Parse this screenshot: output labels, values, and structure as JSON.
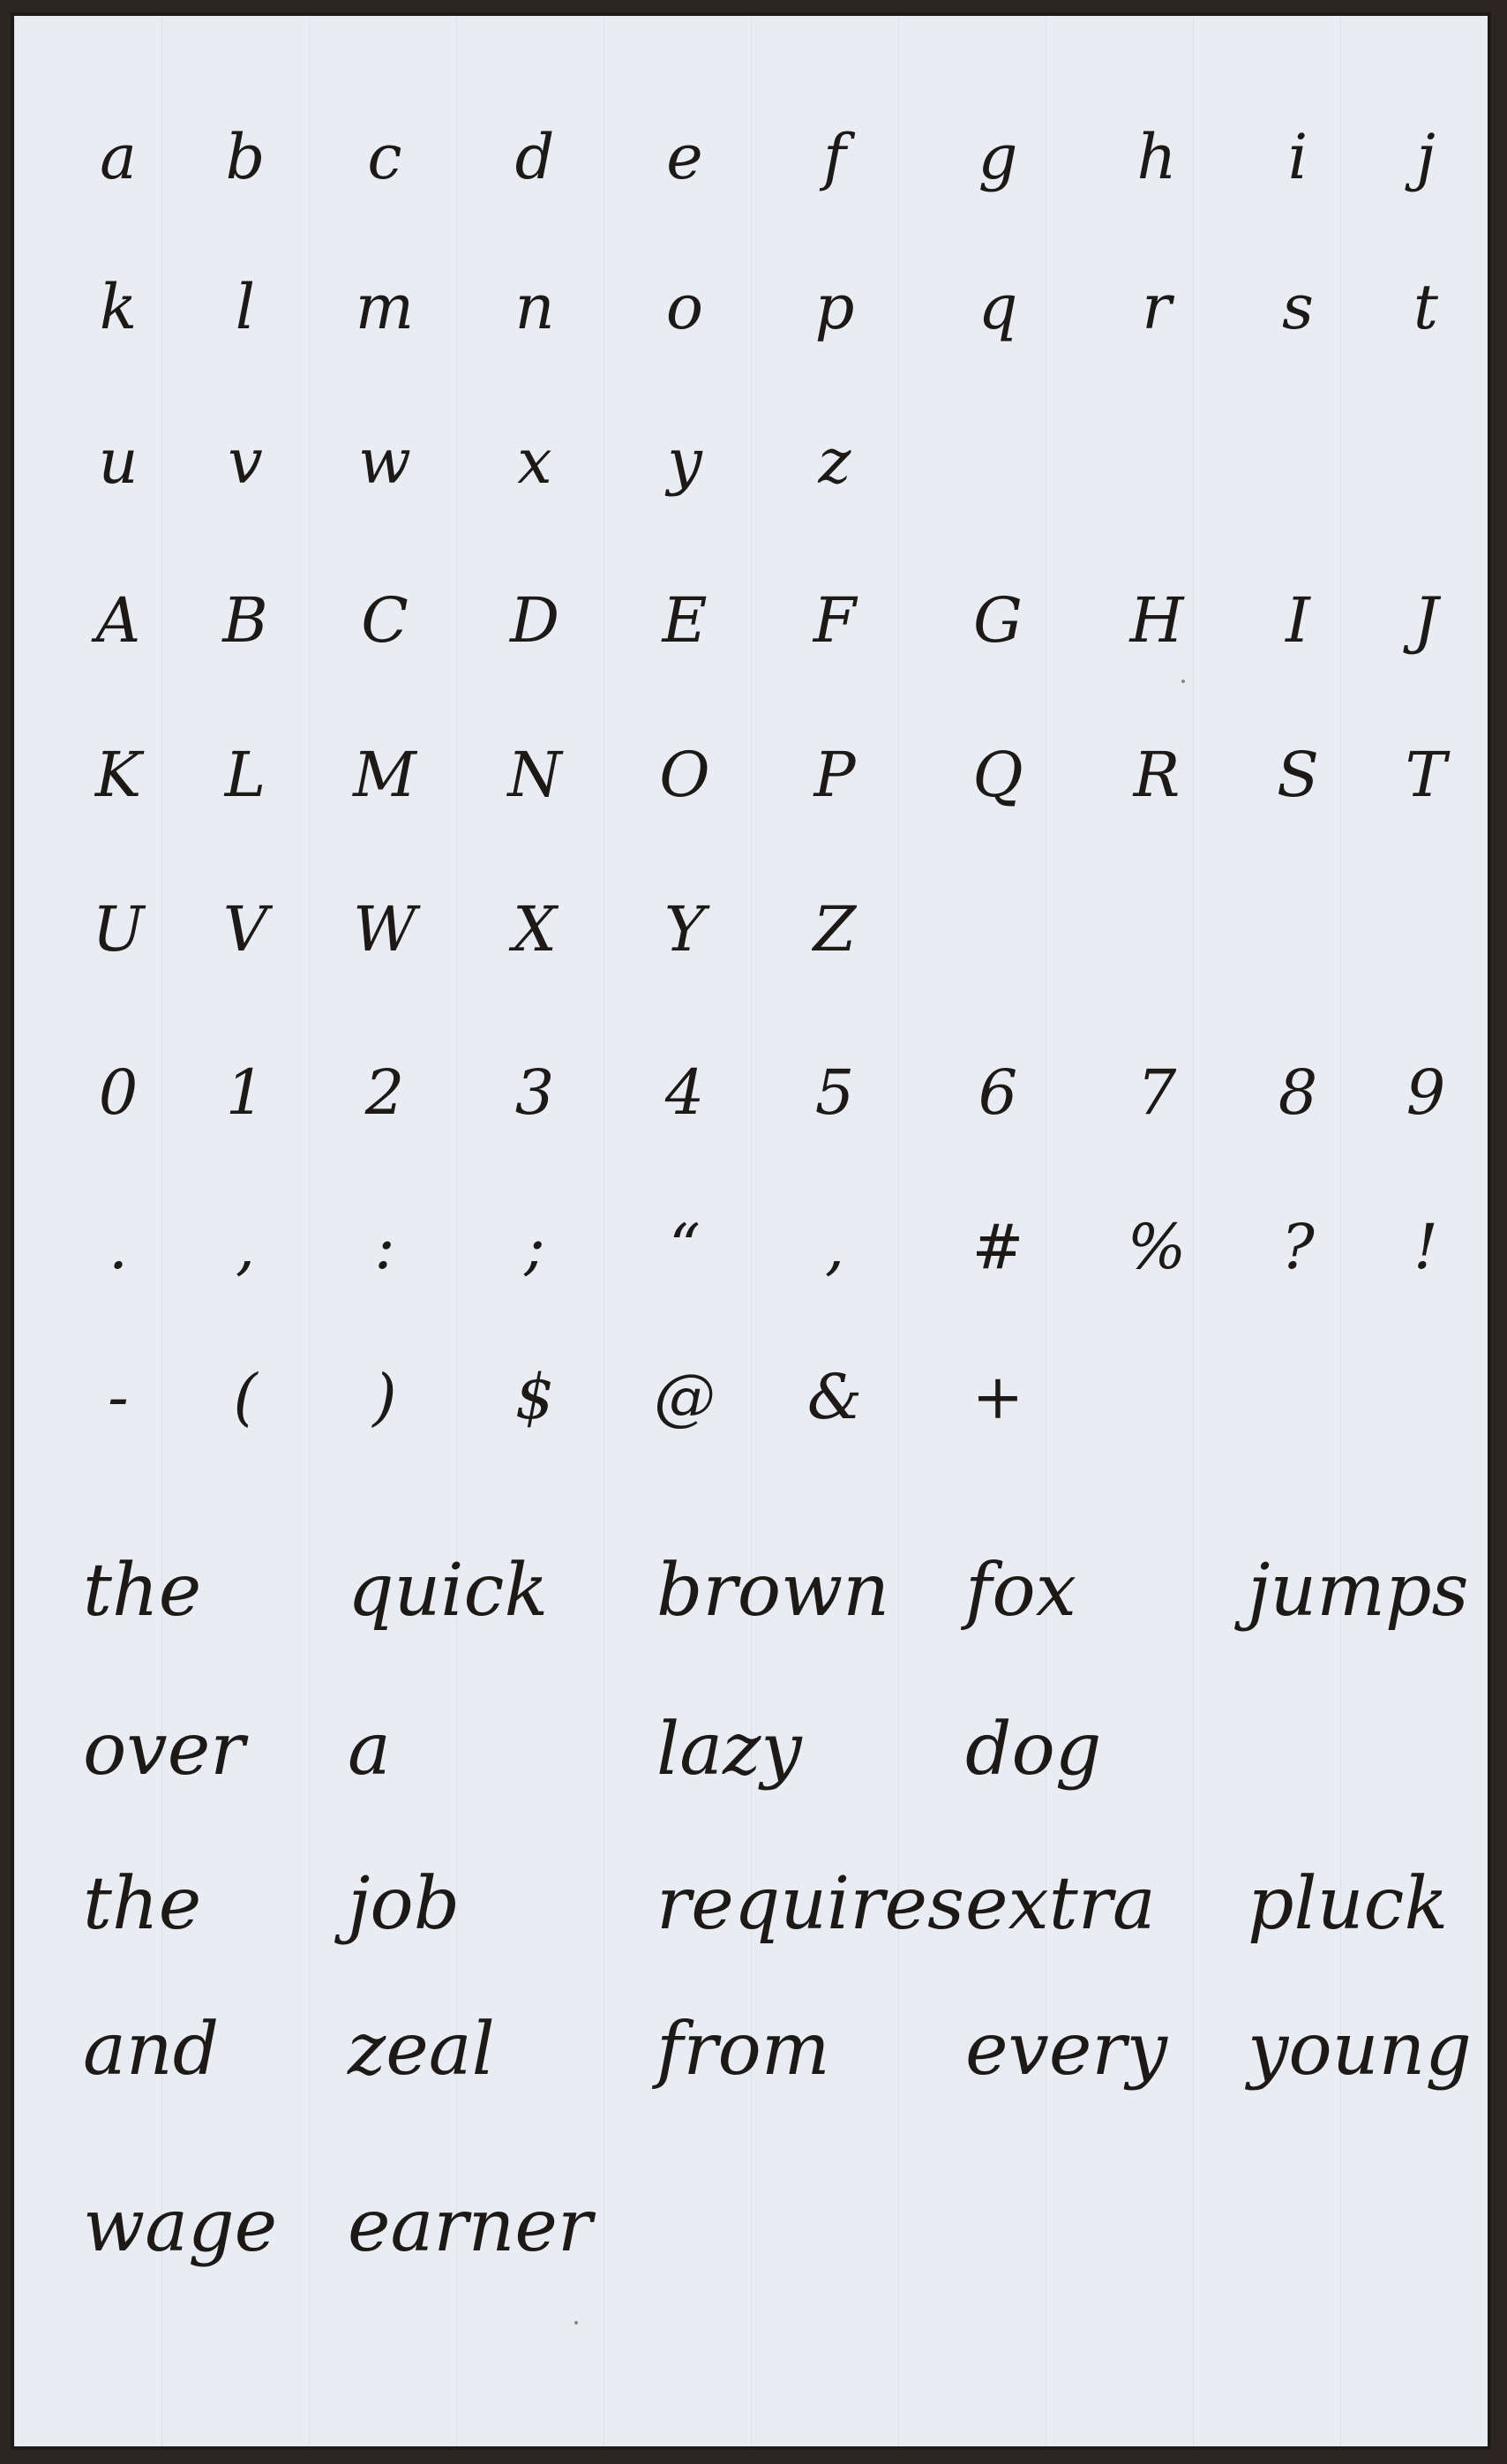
{
  "rows": [
    [
      "a",
      "b",
      "c",
      "d",
      "e",
      "f",
      "g",
      "h",
      "i",
      "j"
    ],
    [
      "k",
      "l",
      "m",
      "n",
      "o",
      "p",
      "q",
      "r",
      "s",
      "t"
    ],
    [
      "u",
      "v",
      "w",
      "x",
      "y",
      "z"
    ],
    [
      "A",
      "B",
      "C",
      "D",
      "E",
      "F",
      "G",
      "H",
      "I",
      "J"
    ],
    [
      "K",
      "L",
      "M",
      "N",
      "O",
      "P",
      "Q",
      "R",
      "S",
      "T"
    ],
    [
      "U",
      "V",
      "W",
      "X",
      "Y",
      "Z"
    ],
    [
      "0",
      "1",
      "2",
      "3",
      "4",
      "5",
      "6",
      "7",
      "8",
      "9"
    ],
    [
      ".",
      ",",
      ":",
      ";",
      "“",
      ",",
      "#",
      "%",
      "?",
      "!"
    ],
    [
      "-",
      "(",
      ")",
      "$",
      "@",
      "&",
      "+"
    ]
  ],
  "sentences": [
    [
      "the",
      "quick",
      "brown",
      "fox",
      "jumps"
    ],
    [
      "over",
      "a",
      "lazy",
      "dog"
    ],
    [
      "the",
      "job",
      "requires",
      "extra",
      "pluck"
    ],
    [
      "and",
      "zeal",
      "from",
      "every",
      "young"
    ],
    [
      "wage",
      "earner"
    ]
  ]
}
